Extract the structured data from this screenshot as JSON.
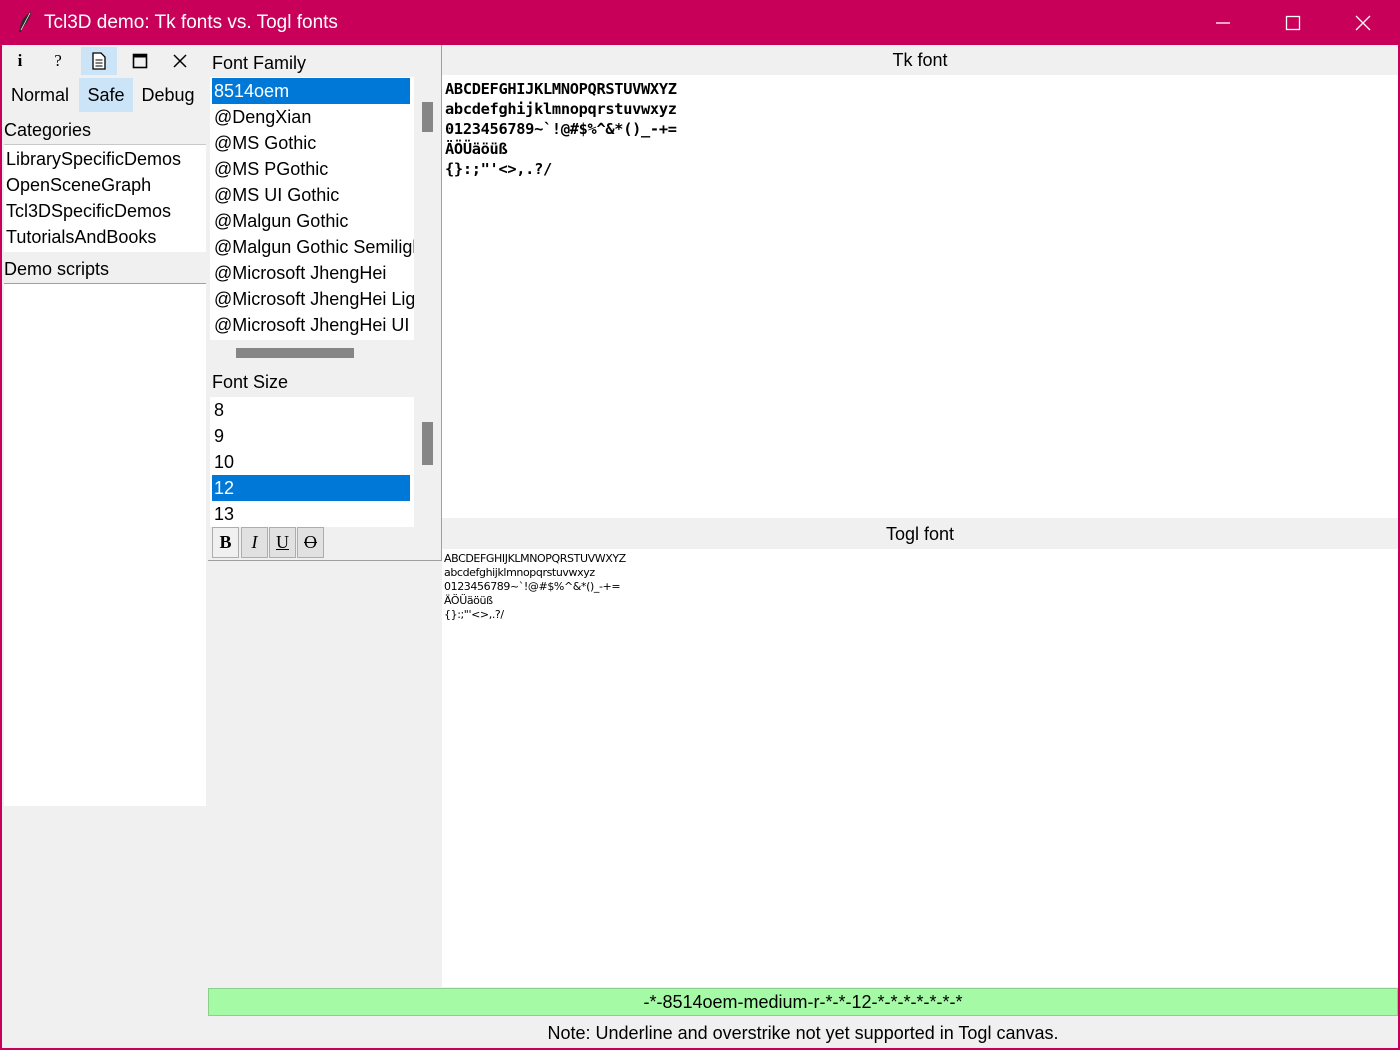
{
  "window": {
    "title": "Tcl3D demo: Tk fonts vs. Togl fonts",
    "controls": [
      "minimize-icon",
      "maximize-icon",
      "close-icon"
    ]
  },
  "toolbar": {
    "info": "i",
    "help": "?",
    "buttons": [
      "info-icon",
      "help-icon",
      "document-icon",
      "window-icon",
      "close-icon"
    ]
  },
  "modes": {
    "normal": "Normal",
    "safe": "Safe",
    "debug": "Debug",
    "active": "Safe"
  },
  "categories": {
    "label": "Categories",
    "items": [
      "LibrarySpecificDemos",
      "OpenSceneGraph",
      "Tcl3DSpecificDemos",
      "TutorialsAndBooks"
    ]
  },
  "demo_scripts": {
    "label": "Demo scripts"
  },
  "font_family": {
    "label": "Font Family",
    "items": [
      "8514oem",
      "@DengXian",
      "@MS Gothic",
      "@MS PGothic",
      "@MS UI Gothic",
      "@Malgun Gothic",
      "@Malgun Gothic Semiligh",
      "@Microsoft JhengHei",
      "@Microsoft JhengHei Ligh",
      "@Microsoft JhengHei UI"
    ],
    "selected": "8514oem"
  },
  "font_size": {
    "label": "Font Size",
    "items": [
      "8",
      "9",
      "10",
      "12",
      "13"
    ],
    "selected": "12"
  },
  "style_buttons": {
    "bold": "B",
    "italic": "I",
    "underline": "U",
    "overstrike": "O"
  },
  "tk_font": {
    "heading": "Tk font",
    "lines": [
      "ABCDEFGHIJKLMNOPQRSTUVWXYZ",
      "abcdefghijklmnopqrstuvwxyz",
      "0123456789~`!@#$%^&*()_-+=",
      "ÄÖÜäöüß",
      "{}:;\"'<>,.?/"
    ]
  },
  "togl_font": {
    "heading": "Togl font",
    "lines": [
      "ABCDEFGHIJKLMNOPQRSTUVWXYZ",
      "abcdefghijklmnopqrstuvwxyz",
      "0123456789~`!@#$%^&*()_-+=",
      "ÄÖÜäöüß",
      "{}:;\"'<>,.?/"
    ]
  },
  "status": "-*-8514oem-medium-r-*-*-12-*-*-*-*-*-*-*",
  "note": "Note: Underline and overstrike not yet supported in Togl canvas.",
  "colors": {
    "titlebar": "#c8005a",
    "selection": "#0078d7",
    "status_bg": "#a5fba5",
    "active_button": "#cce4f7"
  }
}
